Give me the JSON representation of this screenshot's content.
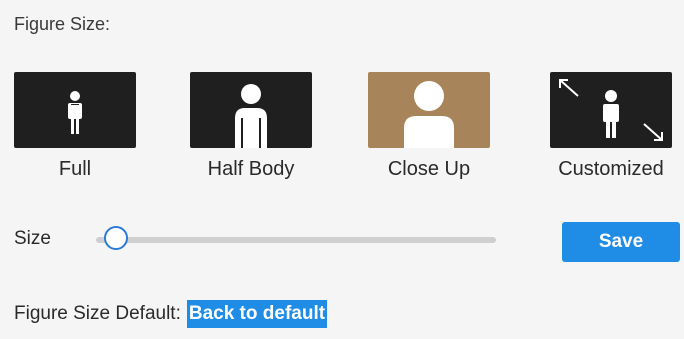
{
  "title": "Figure Size:",
  "options": [
    {
      "label": "Full",
      "icon": "full-figure-icon",
      "selected": false
    },
    {
      "label": "Half Body",
      "icon": "half-body-icon",
      "selected": false
    },
    {
      "label": "Close Up",
      "icon": "close-up-icon",
      "selected": true
    },
    {
      "label": "Customized",
      "icon": "customized-icon",
      "selected": false
    }
  ],
  "size": {
    "label": "Size",
    "value": 0.02
  },
  "save_label": "Save",
  "default_row": {
    "label": "Figure Size Default:",
    "link": "Back to default"
  },
  "colors": {
    "accent": "#1f8ce6",
    "selected_thumb": "#a8845a",
    "thumb_bg": "#1f1f1f"
  }
}
